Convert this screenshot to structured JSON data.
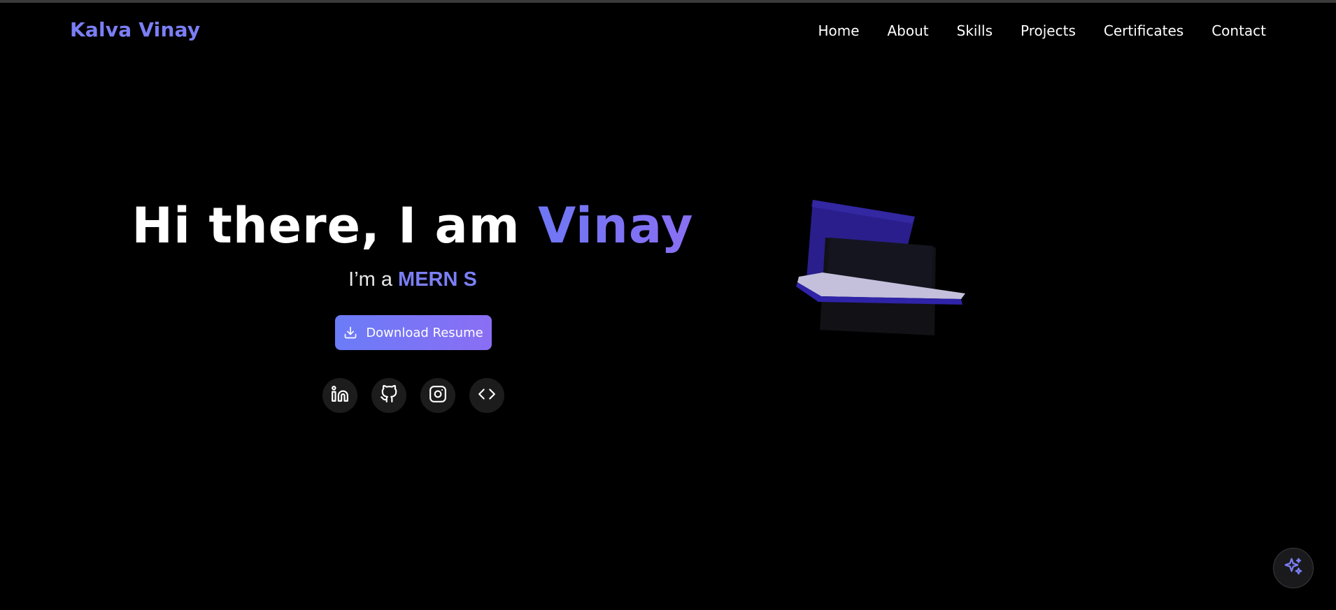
{
  "nav": {
    "brand": "Kalva Vinay",
    "links": [
      "Home",
      "About",
      "Skills",
      "Projects",
      "Certificates",
      "Contact"
    ]
  },
  "hero": {
    "greeting": "Hi there, I am ",
    "name": "Vinay",
    "sub_prefix": "I’m a ",
    "role_text": "MERN S",
    "resume_label": "Download Resume"
  },
  "socials": [
    "linkedin-icon",
    "github-icon",
    "instagram-icon",
    "code-icon"
  ],
  "icons": {
    "resume": "download-icon",
    "fab": "sparkles-icon"
  },
  "colors": {
    "background": "#000000",
    "accent": "#7b7ff5",
    "accent_gradient_start": "#6b7cf7",
    "accent_gradient_end": "#8a6ef4",
    "social_bg": "#1c1c1c"
  }
}
